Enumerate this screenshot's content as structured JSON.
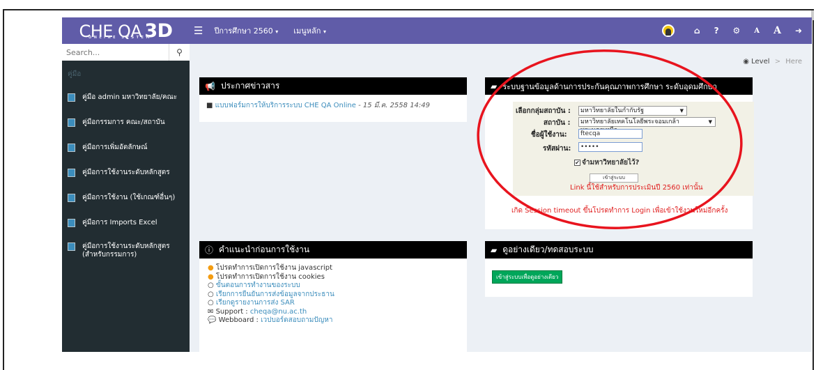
{
  "header": {
    "logo_main": "CHE QA",
    "logo_3d": "3D",
    "logo_sub": "ONLINE SYSTEM",
    "menu_year": "ปีการศึกษา 2560",
    "menu_main": "เมนูหลัก",
    "right_icons": [
      "home-icon",
      "help-icon",
      "settings-icon",
      "font-small-icon",
      "font-large-icon",
      "logout-icon"
    ],
    "font_small": "A",
    "font_large": "A"
  },
  "sidebar": {
    "search_placeholder": "Search...",
    "section": "คู่มือ",
    "items": [
      {
        "label": "คู่มือ admin มหาวิทยาลัย/คณะ"
      },
      {
        "label": "คู่มือกรรมการ คณะ/สถาบัน"
      },
      {
        "label": "คู่มือการเพิ่มอัตลักษณ์"
      },
      {
        "label": "คู่มือการใช้งานระดับหลักสูตร"
      },
      {
        "label": "คู่มือการใช้งาน (ใช้เกณฑ์อื่นๆ)"
      },
      {
        "label": "คู่มือการ Imports Excel"
      },
      {
        "label": "คู่มือการใช้งานระดับหลักสูตร (สำหรับกรรมการ)"
      }
    ]
  },
  "breadcrumb": {
    "level": "Level",
    "sep": ">",
    "here": "Here"
  },
  "news": {
    "title": "ประกาศข่าวสาร",
    "link": "แบบฟอร์มการให้บริการระบบ CHE QA Online",
    "date": "- 15 มี.ค. 2558 14:49"
  },
  "login": {
    "title": "ระบบฐานข้อมูลด้านการประกันคุณภาพการศึกษา ระดับอุดมศึกษา",
    "group_label": "เลือกกลุ่มสถาบัน :",
    "group_value": "มหาวิทยาลัยในกำกับรัฐ",
    "inst_label": "สถาบัน :",
    "inst_value": "มหาวิทยาลัยเทคโนโลยีพระจอมเกล้าพระนครเหนือ",
    "user_label": "ชื่อผู้ใช้งาน:",
    "user_value": "ftecqa",
    "pass_label": "รหัสผ่าน:",
    "pass_value": "•••••",
    "remember": "จำมหาวิทยาลัยไว้?",
    "button": "เข้าสู่ระบบ",
    "note": "Link นี้ใช้สำหรับการประเมินปี 2560 เท่านั้น",
    "timeout": "เกิด Session timeout ขึ้นโปรดทำการ Login เพื่อเข้าใช้งานใหม่อีกครั้ง"
  },
  "guide": {
    "title": "คำแนะนำก่อนการใช้งาน",
    "lines": [
      "โปรดทำการเปิดการใช้งาน javascript",
      "โปรดทำการเปิดการใช้งาน cookies",
      "ขั้นตอนการทำงานของระบบ",
      "เรียกการยืนยันการส่งข้อมูลจากประธาน",
      "เรียกดูรายงานการส่ง SAR"
    ],
    "support_label": "Support :",
    "support_value": "cheqa@nu.ac.th",
    "webboard_label": "Webboard :",
    "webboard_value": "เวปบอร์ดสอบถามปัญหา"
  },
  "demo": {
    "title": "ดูอย่างเดียว/ทดสอบระบบ",
    "button": "เข้าสู่ระบบเพื่อดูอย่างเดียว"
  },
  "colors": {
    "topbar": "#605ca8",
    "sidebar": "#222d32",
    "oval": "#e8141e",
    "demo_button": "#00a65a"
  }
}
